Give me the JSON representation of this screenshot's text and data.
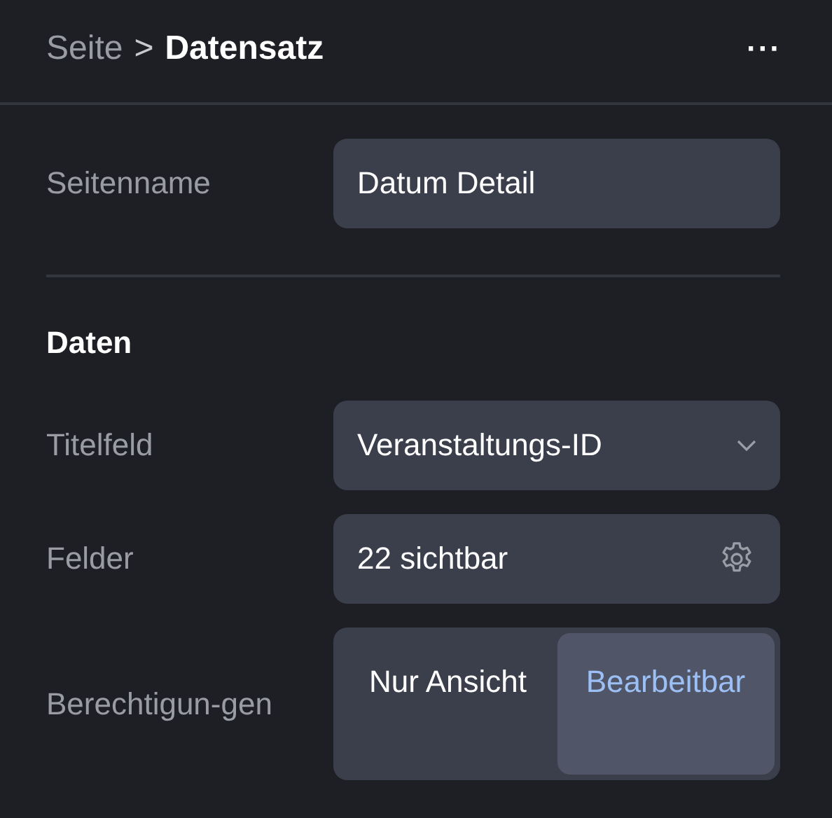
{
  "breadcrumb": {
    "parent": "Seite",
    "separator": ">",
    "current": "Datensatz"
  },
  "menu_button": "···",
  "page_name": {
    "label": "Seitenname",
    "value": "Datum Detail"
  },
  "section": {
    "title": "Daten",
    "rows": [
      {
        "kind": "select",
        "label": "Titelfeld",
        "value": "Veranstaltungs-ID"
      },
      {
        "kind": "settings",
        "label": "Felder",
        "value": "22 sichtbar"
      },
      {
        "kind": "segmented",
        "label": "Berechtigun-gen",
        "options": [
          {
            "label": "Nur Ansicht",
            "selected": false
          },
          {
            "label": "Bearbeitbar",
            "selected": true
          }
        ]
      }
    ]
  }
}
